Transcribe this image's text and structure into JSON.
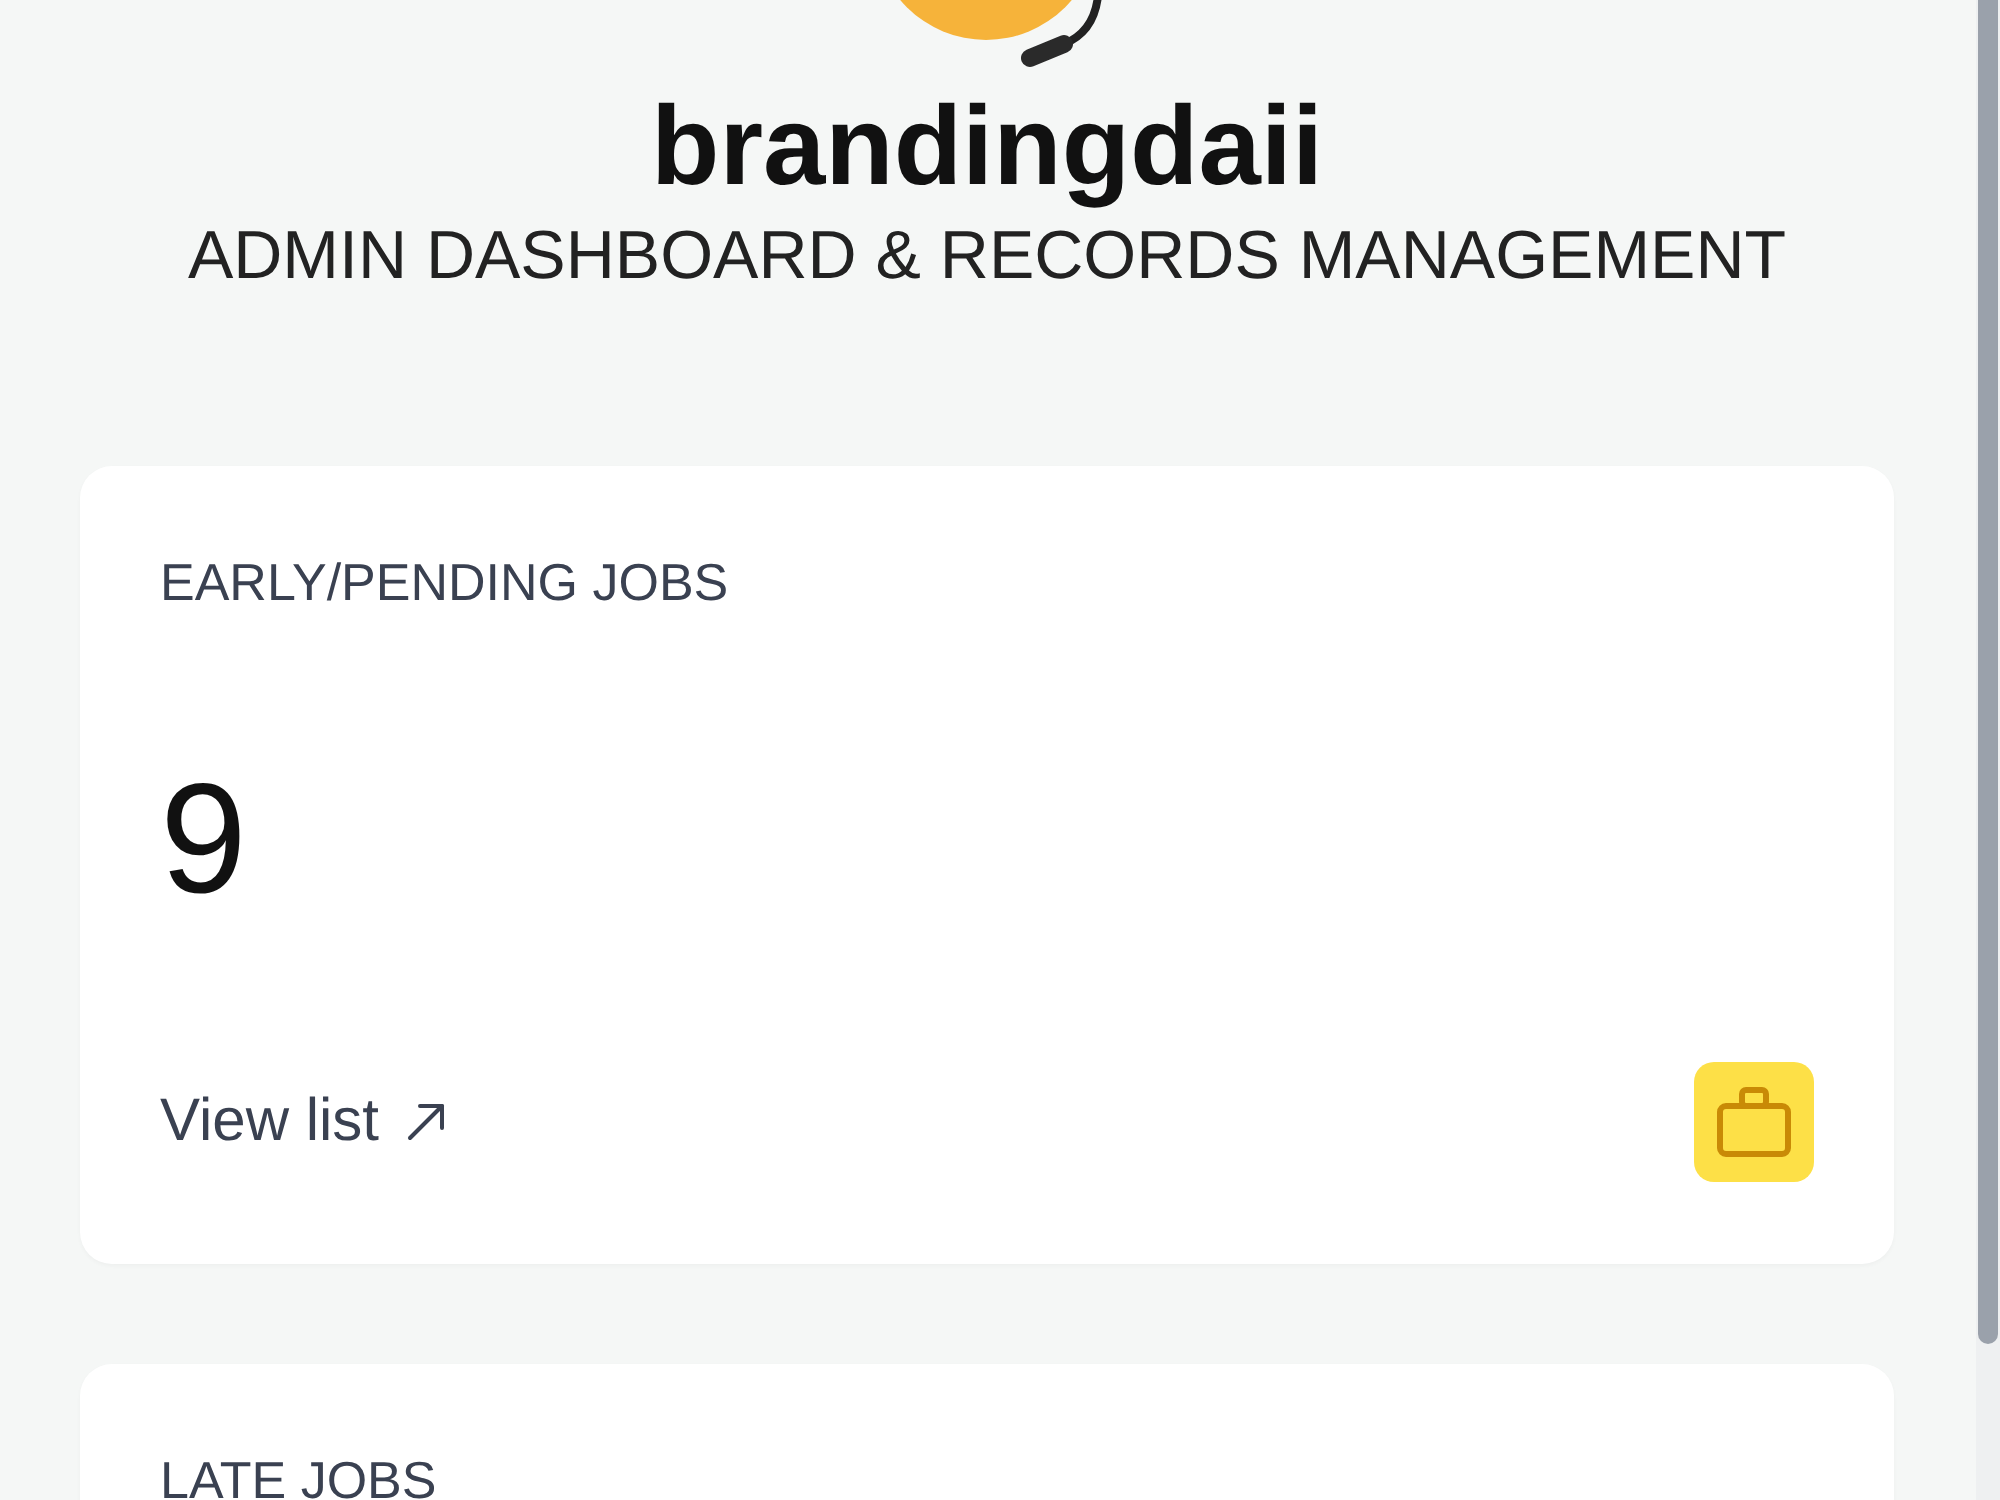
{
  "header": {
    "wordmark": "brandingdaii",
    "subtitle": "ADMIN DASHBOARD & RECORDS MANAGEMENT"
  },
  "cards": [
    {
      "label": "EARLY/PENDING JOBS",
      "count": "9",
      "link": "View list",
      "color": "#fde047"
    },
    {
      "label": "LATE JOBS"
    }
  ]
}
